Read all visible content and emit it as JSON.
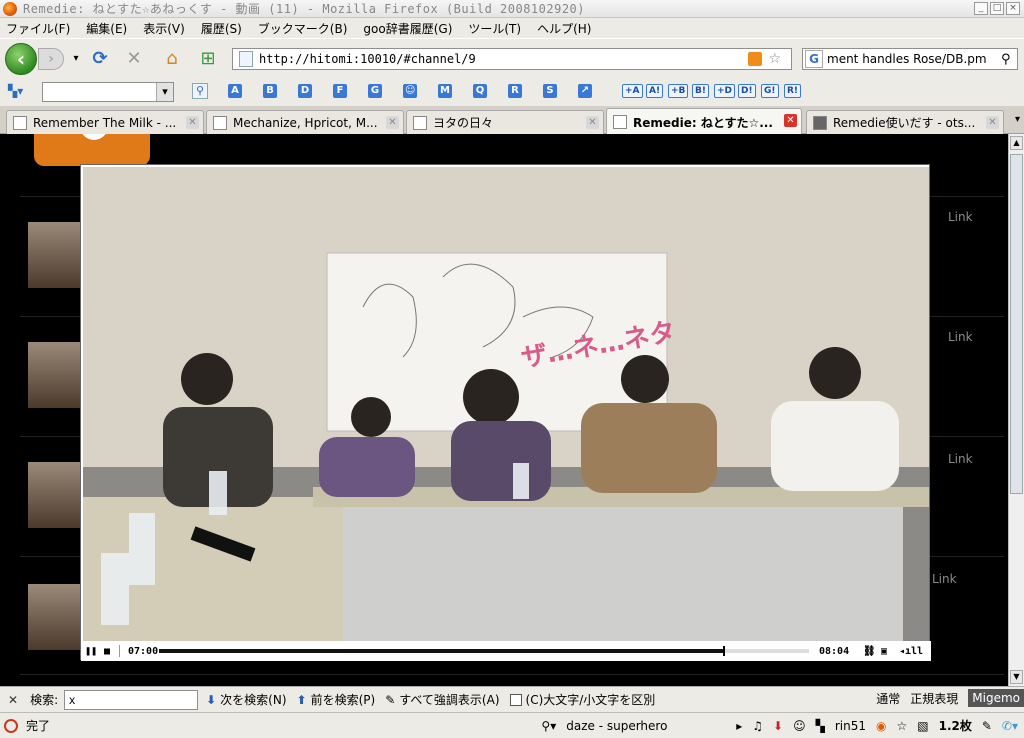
{
  "window": {
    "title": "Remedie: ねとすた☆あねっくす - 動画 (11) - Mozilla Firefox (Build 2008102920)"
  },
  "menu": [
    "ファイル(F)",
    "編集(E)",
    "表示(V)",
    "履歴(S)",
    "ブックマーク(B)",
    "goo辞書履歴(G)",
    "ツール(T)",
    "ヘルプ(H)"
  ],
  "nav": {
    "url": "http://hitomi:10010/#channel/9",
    "search_value": "ment handles Rose/DB.pm"
  },
  "bookmarks": [
    "A",
    "B",
    "D",
    "F",
    "G",
    "M",
    "Q",
    "R",
    "S"
  ],
  "bookmarks_boxed": [
    "+A",
    "A!",
    "+B",
    "B!",
    "+D",
    "D!",
    "G!",
    "R!"
  ],
  "tabs": [
    {
      "label": "Remember The Milk - ..."
    },
    {
      "label": "Mechanize, Hpricot, M..."
    },
    {
      "label": "ヨタの日々"
    },
    {
      "label": "Remedie: ねとすた☆..."
    },
    {
      "label": "Remedie使いだす - ots..."
    }
  ],
  "list": {
    "link_label": "Link"
  },
  "player": {
    "elapsed": "07:00",
    "duration": "08:04",
    "progress": 0.868
  },
  "findbar": {
    "label": "検索:",
    "value": "x",
    "next": "次を検索(N)",
    "prev": "前を検索(P)",
    "highlight": "すべて強調表示(A)",
    "matchcase": "(C)大文字/小文字を区別",
    "mode_normal": "通常",
    "mode_regex": "正規表現",
    "migemo": "Migemo"
  },
  "status": {
    "text": "完了",
    "music": "daze - superhero",
    "user": "rin51",
    "zoom": "1.2枚"
  }
}
